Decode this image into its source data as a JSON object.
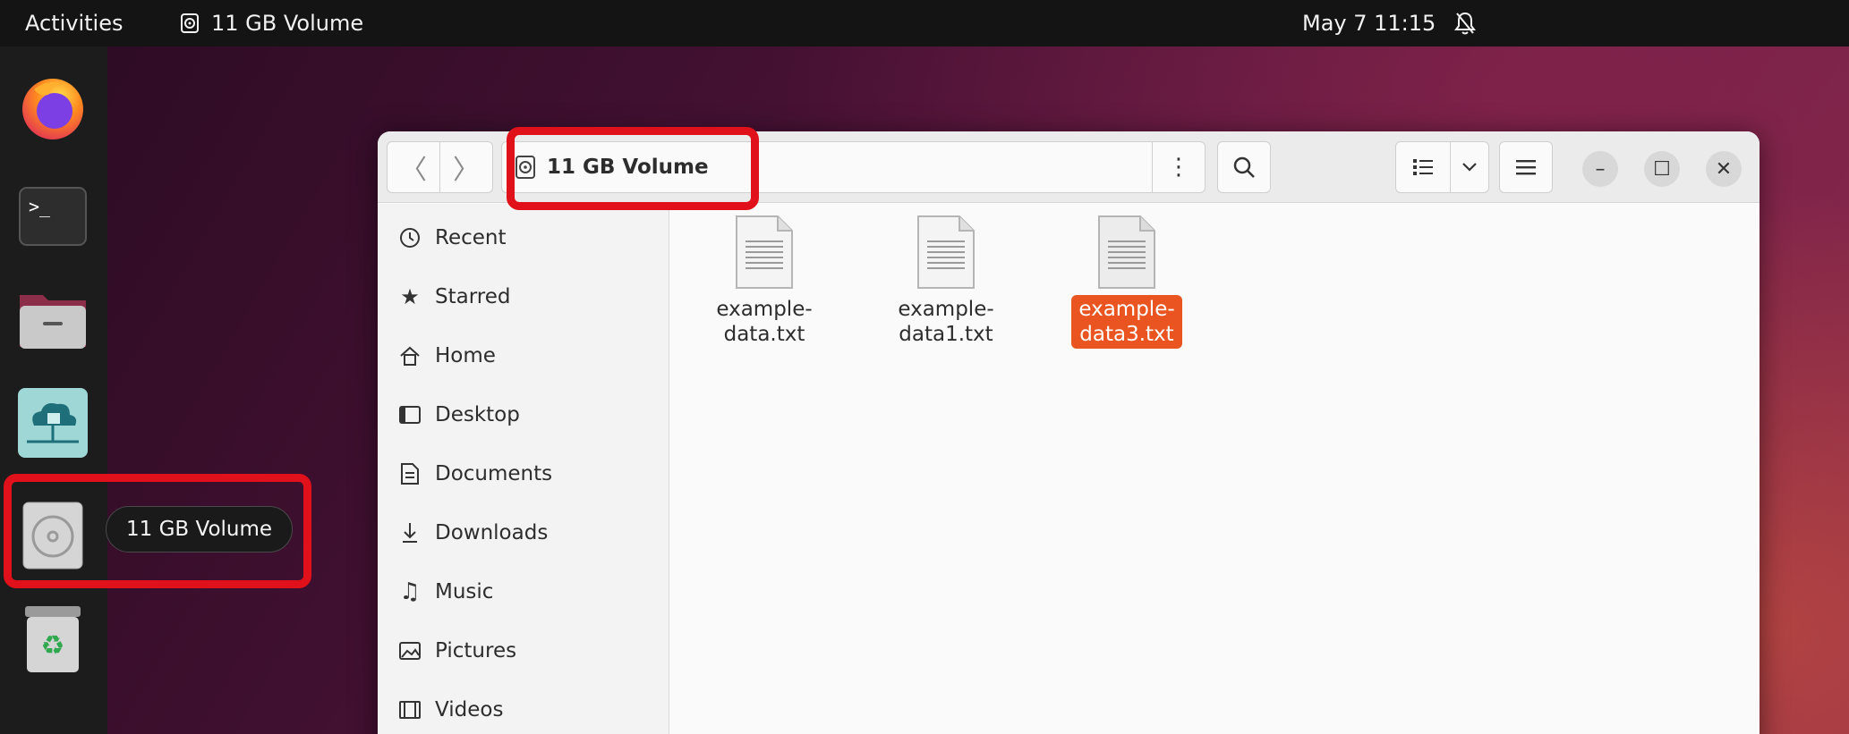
{
  "topbar": {
    "activities": "Activities",
    "app_title": "11 GB Volume",
    "datetime": "May 7  11:15"
  },
  "dock": {
    "items": [
      "firefox",
      "terminal",
      "files",
      "cloud-app",
      "11 GB Volume",
      "trash"
    ],
    "tooltip": "11 GB Volume"
  },
  "window": {
    "path_label": "11 GB Volume"
  },
  "sidebar": {
    "items": [
      {
        "label": "Recent",
        "icon": "clock-icon"
      },
      {
        "label": "Starred",
        "icon": "star-icon"
      },
      {
        "label": "Home",
        "icon": "home-icon"
      },
      {
        "label": "Desktop",
        "icon": "desktop-icon"
      },
      {
        "label": "Documents",
        "icon": "document-icon"
      },
      {
        "label": "Downloads",
        "icon": "download-icon"
      },
      {
        "label": "Music",
        "icon": "music-icon"
      },
      {
        "label": "Pictures",
        "icon": "picture-icon"
      },
      {
        "label": "Videos",
        "icon": "video-icon"
      }
    ]
  },
  "files": [
    {
      "name": "example-\ndata.txt",
      "selected": false
    },
    {
      "name": "example-\ndata1.txt",
      "selected": false
    },
    {
      "name": "example-\ndata3.txt",
      "selected": true
    }
  ],
  "colors": {
    "accent": "#e95420",
    "annotation_red": "#e0111a"
  }
}
